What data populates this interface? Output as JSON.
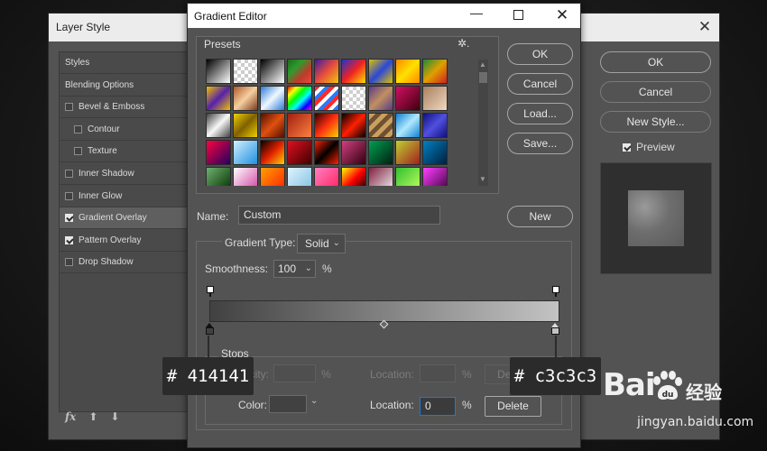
{
  "layer_style": {
    "title": "Layer Style",
    "close_glyph": "✕",
    "items": [
      {
        "label": "Styles",
        "checkbox": false,
        "checked": false,
        "sub": false,
        "active": false
      },
      {
        "label": "Blending Options",
        "checkbox": false,
        "checked": false,
        "sub": false,
        "active": false
      },
      {
        "label": "Bevel & Emboss",
        "checkbox": true,
        "checked": false,
        "sub": false,
        "active": false
      },
      {
        "label": "Contour",
        "checkbox": true,
        "checked": false,
        "sub": true,
        "active": false
      },
      {
        "label": "Texture",
        "checkbox": true,
        "checked": false,
        "sub": true,
        "active": false
      },
      {
        "label": "Inner Shadow",
        "checkbox": true,
        "checked": false,
        "sub": false,
        "active": false
      },
      {
        "label": "Inner Glow",
        "checkbox": true,
        "checked": false,
        "sub": false,
        "active": false
      },
      {
        "label": "Gradient Overlay",
        "checkbox": true,
        "checked": true,
        "sub": false,
        "active": true
      },
      {
        "label": "Pattern Overlay",
        "checkbox": true,
        "checked": true,
        "sub": false,
        "active": false
      },
      {
        "label": "Drop Shadow",
        "checkbox": true,
        "checked": false,
        "sub": false,
        "active": false
      }
    ],
    "footer": {
      "fx": "fx",
      "up": "⬆",
      "down": "⬇"
    },
    "buttons": {
      "ok": "OK",
      "cancel": "Cancel",
      "new_style": "New Style..."
    },
    "preview_label": "Preview",
    "preview_checked": true
  },
  "gradient_editor": {
    "title": "Gradient Editor",
    "min_glyph": "—",
    "close_glyph": "✕",
    "presets_label": "Presets",
    "presets_gear": "✲.",
    "preset_swatches": [
      "linear-gradient(135deg,#000,#fff)",
      "repeating-conic-gradient(#ccc 0 25%,#fff 0 50%) 0 0/8px 8px",
      "linear-gradient(135deg,#000,#fff)",
      "linear-gradient(135deg,#1e6b1e,#2e9a2e,#c0392b,#e74c3c)",
      "linear-gradient(135deg,#3b1c9e,#e74c3c,#f1c40f)",
      "linear-gradient(135deg,#2233cc,#ee2222,#ffdd00)",
      "linear-gradient(135deg,#e0c000,#2a47d8,#e0c000)",
      "linear-gradient(135deg,#ff8800,#ffe000,#ff8800)",
      "linear-gradient(135deg,#1a8a3a,#e0a000,#d02020)",
      "linear-gradient(135deg,#f0c000,#5522aa,#f0c000)",
      "linear-gradient(135deg,#b05a2a,#f5cfa0,#7a3a1a)",
      "linear-gradient(135deg,#2a7ad8,#f0f8ff,#2a7ad8)",
      "linear-gradient(135deg,#ff0000,#ffff00,#00ff00,#00ffff,#0000ff,#ff00ff)",
      "repeating-linear-gradient(135deg,#ff2a2a 0 4px,#ffffff 4px 8px,#2a7aff 8px 12px)",
      "repeating-conic-gradient(#cfcfcf 0 25%,#fff 0 50%) 0 0/8px 8px",
      "linear-gradient(135deg,#5a3a8a,#c09060,#5a3a8a)",
      "linear-gradient(135deg,#d01060,#400010)",
      "linear-gradient(135deg,#a88060,#f0d8c0)",
      "linear-gradient(135deg,#404040,#f8f8f8,#404040)",
      "linear-gradient(135deg,#f0d000,#806000,#f0d000)",
      "linear-gradient(135deg,#501000,#e05010,#501000)",
      "linear-gradient(135deg,#a02010,#ff8040)",
      "linear-gradient(135deg,#300000,#ff3010,#ffd000)",
      "linear-gradient(135deg,#000,#ff2000,#000)",
      "repeating-linear-gradient(135deg,#c8a060 0 5px,#705030 5px 10px)",
      "linear-gradient(135deg,#1080d0,#b0e8ff,#1080d0)",
      "linear-gradient(135deg,#101080,#5050e0,#101080)",
      "linear-gradient(135deg,#ff0040,#200060)",
      "linear-gradient(135deg,#d0f0ff,#2090e0)",
      "linear-gradient(135deg,#000,#e02000,#ffd000)",
      "linear-gradient(135deg,#e01020,#400000)",
      "linear-gradient(135deg,#ff2000,#000,#ff2000)",
      "linear-gradient(135deg,#d04080,#300010)",
      "linear-gradient(135deg,#00a050,#002010)",
      "linear-gradient(135deg,#c0d030,#a02020)",
      "linear-gradient(135deg,#0080c0,#002040)",
      "linear-gradient(135deg,#70b070,#003000)",
      "linear-gradient(135deg,#ffffff,#d040a0)",
      "linear-gradient(135deg,#ffa000,#ff2000)",
      "linear-gradient(135deg,#e0f4ff,#80c0e0)",
      "linear-gradient(135deg,#ff80c0,#ff2060)",
      "linear-gradient(135deg,#ffff00,#ff0000,#000)",
      "linear-gradient(135deg,#802040,#f0f0f0)",
      "linear-gradient(135deg,#30c030,#c0ff60)",
      "linear-gradient(135deg,#ff40ff,#400040)"
    ],
    "scroll_up": "▲",
    "scroll_down": "▼",
    "buttons": {
      "ok": "OK",
      "cancel": "Cancel",
      "load": "Load...",
      "save": "Save...",
      "new": "New"
    },
    "name_label": "Name:",
    "name_value": "Custom",
    "gradient_type_label": "Gradient Type:",
    "gradient_type_value": "Solid",
    "smoothness_label": "Smoothness:",
    "smoothness_value": "100",
    "percent": "%",
    "chevron": "⌄",
    "gradient_bar": "linear-gradient(90deg,#414141,#c3c3c3)",
    "stops": {
      "label": "Stops",
      "opacity_label": "Opacity:",
      "opacity_location_label": "Location:",
      "opacity_delete": "Delete",
      "color_label": "Color:",
      "color_location_label": "Location:",
      "color_location_value": "0",
      "color_delete": "Delete"
    },
    "left_stop_color": "#414141",
    "right_stop_color": "#c3c3c3"
  },
  "callouts": {
    "left": "# 414141",
    "right": "# c3c3c3"
  },
  "watermark": {
    "logo": "Bai",
    "cn": "经验",
    "url": "jingyan.baidu.com"
  }
}
